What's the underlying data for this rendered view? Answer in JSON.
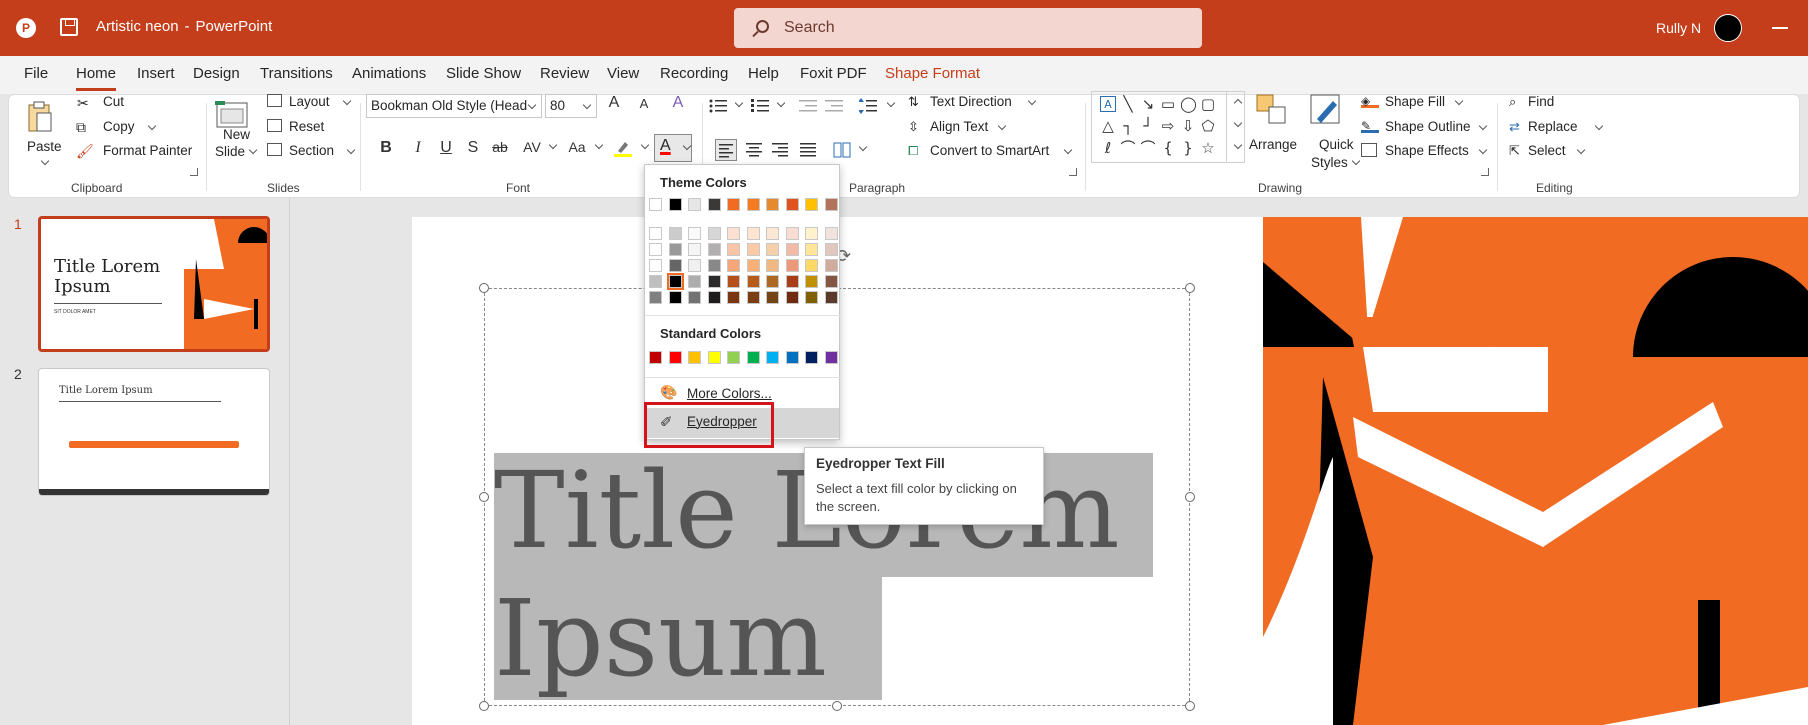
{
  "titlebar": {
    "doc_name": "Artistic neon",
    "separator": "-",
    "app_name": "PowerPoint",
    "user_name": "Rully N"
  },
  "search": {
    "placeholder": "Search"
  },
  "menu_tabs": [
    "File",
    "Home",
    "Insert",
    "Design",
    "Transitions",
    "Animations",
    "Slide Show",
    "Review",
    "View",
    "Recording",
    "Help",
    "Foxit PDF",
    "Shape Format"
  ],
  "ribbon": {
    "clipboard": {
      "paste": "Paste",
      "cut": "Cut",
      "copy": "Copy",
      "format_painter": "Format Painter",
      "label": "Clipboard"
    },
    "slides": {
      "new_slide_1": "New",
      "new_slide_2": "Slide",
      "layout": "Layout",
      "reset": "Reset",
      "section": "Section",
      "label": "Slides"
    },
    "font": {
      "font_name": "Bookman Old Style (Head",
      "font_size": "80",
      "grow": "A",
      "shrink": "A",
      "bold": "B",
      "italic": "I",
      "underline": "U",
      "shadow": "S",
      "strike": "ab",
      "spacing": "AV",
      "case": "Aa",
      "label": "Font"
    },
    "paragraph": {
      "text_direction": "Text Direction",
      "align_text": "Align Text",
      "convert_smartart": "Convert to SmartArt",
      "label": "Paragraph"
    },
    "drawing": {
      "arrange": "Arrange",
      "quick_1": "Quick",
      "quick_2": "Styles",
      "shape_fill": "Shape Fill",
      "shape_outline": "Shape Outline",
      "shape_effects": "Shape Effects",
      "label": "Drawing"
    },
    "editing": {
      "find": "Find",
      "replace": "Replace",
      "select": "Select",
      "label": "Editing"
    }
  },
  "color_menu": {
    "theme_header": "Theme Colors",
    "standard_header": "Standard Colors",
    "more_colors": "More Colors...",
    "eyedropper": "Eyedropper",
    "theme_row": [
      "#ffffff",
      "#000000",
      "#e7e6e6",
      "#3b3838",
      "#f26b22",
      "#f47b20",
      "#e68a2e",
      "#e0531f",
      "#ffc000",
      "#b3735a"
    ],
    "standard_row": [
      "#c00000",
      "#ff0000",
      "#ffc000",
      "#ffff00",
      "#92d050",
      "#00b050",
      "#00b0f0",
      "#0070c0",
      "#002060",
      "#7030a0"
    ]
  },
  "tooltip": {
    "title": "Eyedropper Text Fill",
    "body": "Select a text fill color by clicking on the screen."
  },
  "thumbnails": [
    {
      "num": "1",
      "title": "Title Lorem Ipsum",
      "subtitle": "SIT DOLOR AMET"
    },
    {
      "num": "2",
      "title": "Title Lorem Ipsum"
    }
  ],
  "slide": {
    "title_line1": "Title Lorem",
    "title_line2": "Ipsum"
  },
  "colors": {
    "accent": "#c43e1c",
    "slide_orange": "#f26b22",
    "highlight_red": "#d3141c"
  }
}
